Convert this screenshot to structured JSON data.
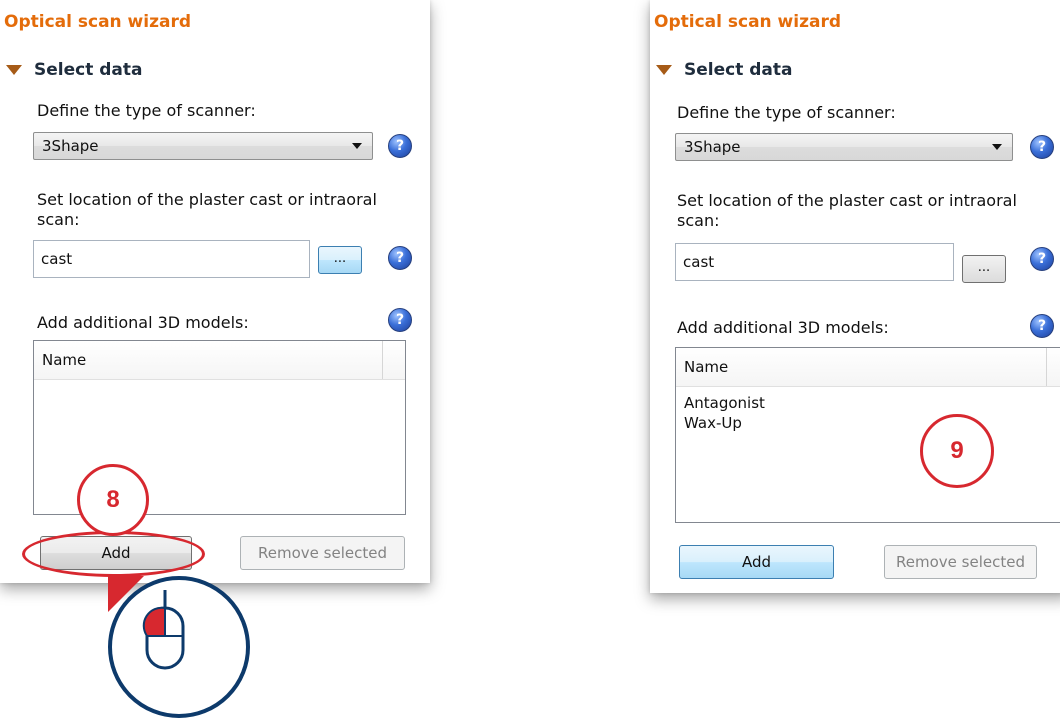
{
  "left_panel": {
    "title": "Optical scan wizard",
    "section": "Select data",
    "scanner_label": "Define the type of scanner:",
    "scanner_value": "3Shape",
    "location_label": "Set location of the plaster cast or intraoral scan:",
    "location_value": "cast",
    "browse_label": "...",
    "models_label": "Add additional 3D models:",
    "list_header": "Name",
    "list_items": [],
    "add_label": "Add",
    "remove_label": "Remove selected",
    "help_glyph": "?"
  },
  "right_panel": {
    "title": "Optical scan wizard",
    "section": "Select data",
    "scanner_label": "Define the type of scanner:",
    "scanner_value": "3Shape",
    "location_label": "Set location of the plaster cast or intraoral scan:",
    "location_value": "cast",
    "browse_label": "...",
    "models_label": "Add additional 3D models:",
    "list_header": "Name",
    "list_items": [
      "Antagonist",
      "Wax-Up"
    ],
    "add_label": "Add",
    "remove_label": "Remove selected",
    "help_glyph": "?"
  },
  "annotations": {
    "step_8": "8",
    "step_9": "9"
  },
  "colors": {
    "title_orange": "#e46c0a",
    "annotation_red": "#d7282f",
    "mouse_blue": "#0d3a6b",
    "help_blue": "#3a6fd8"
  },
  "icons": {
    "expand": "triangle-down-icon",
    "help": "help-icon",
    "mouse": "mouse-icon"
  }
}
